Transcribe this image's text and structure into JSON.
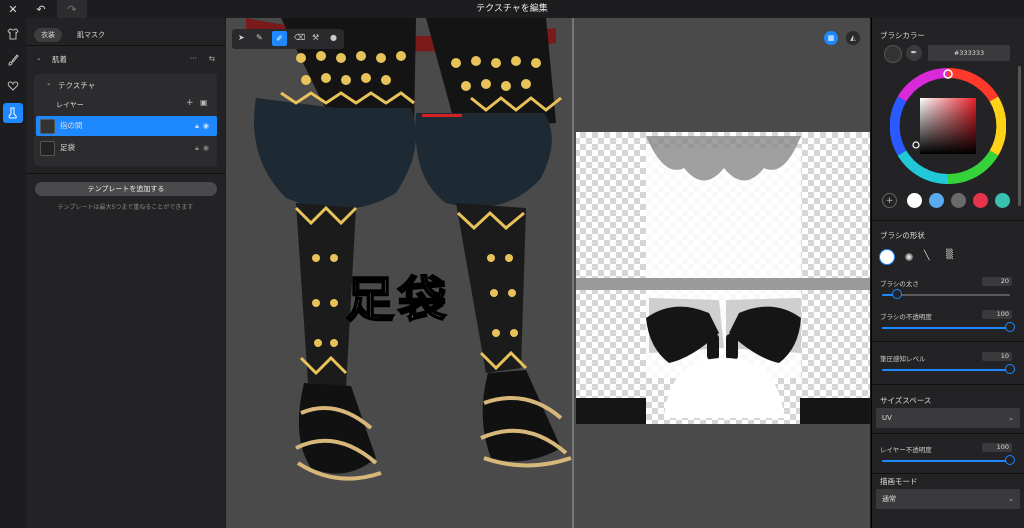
{
  "window": {
    "title": "テクスチャを編集"
  },
  "tabs": {
    "costume": "衣装",
    "skin_mask": "肌マスク"
  },
  "sections": {
    "underwear": "肌着",
    "texture": "テクスチャ",
    "layer": "レイヤー"
  },
  "layers": [
    {
      "name": "指の間",
      "selected": true
    },
    {
      "name": "足袋",
      "selected": false
    }
  ],
  "template": {
    "button": "テンプレートを追加する",
    "hint": "テンプレートは最大5つまで重ねることができます"
  },
  "viewport": {
    "overlay_text": "足袋"
  },
  "right": {
    "brush_color_title": "ブラシカラー",
    "hex": "#333333",
    "brush_shape_title": "ブラシの形状",
    "brush_size_label": "ブラシの太さ",
    "brush_size_value": "20",
    "brush_opacity_label": "ブラシの不透明度",
    "brush_opacity_value": "100",
    "pressure_label": "筆圧感知レベル",
    "pressure_value": "10",
    "size_space_title": "サイズスペース",
    "size_space_value": "UV",
    "layer_opacity_label": "レイヤー不透明度",
    "layer_opacity_value": "100",
    "draw_mode_title": "描画モード",
    "draw_mode_value": "通常"
  },
  "colors": {
    "accent": "#1e88ff",
    "swatches": [
      "#ffffff",
      "#5aaaf0",
      "#6a6a6a",
      "#e8344a",
      "#39c0b0"
    ]
  },
  "sliders": {
    "brush_size_fraction": 0.12,
    "brush_opacity_fraction": 1.0,
    "pressure_fraction": 1.0,
    "layer_opacity_fraction": 1.0
  }
}
